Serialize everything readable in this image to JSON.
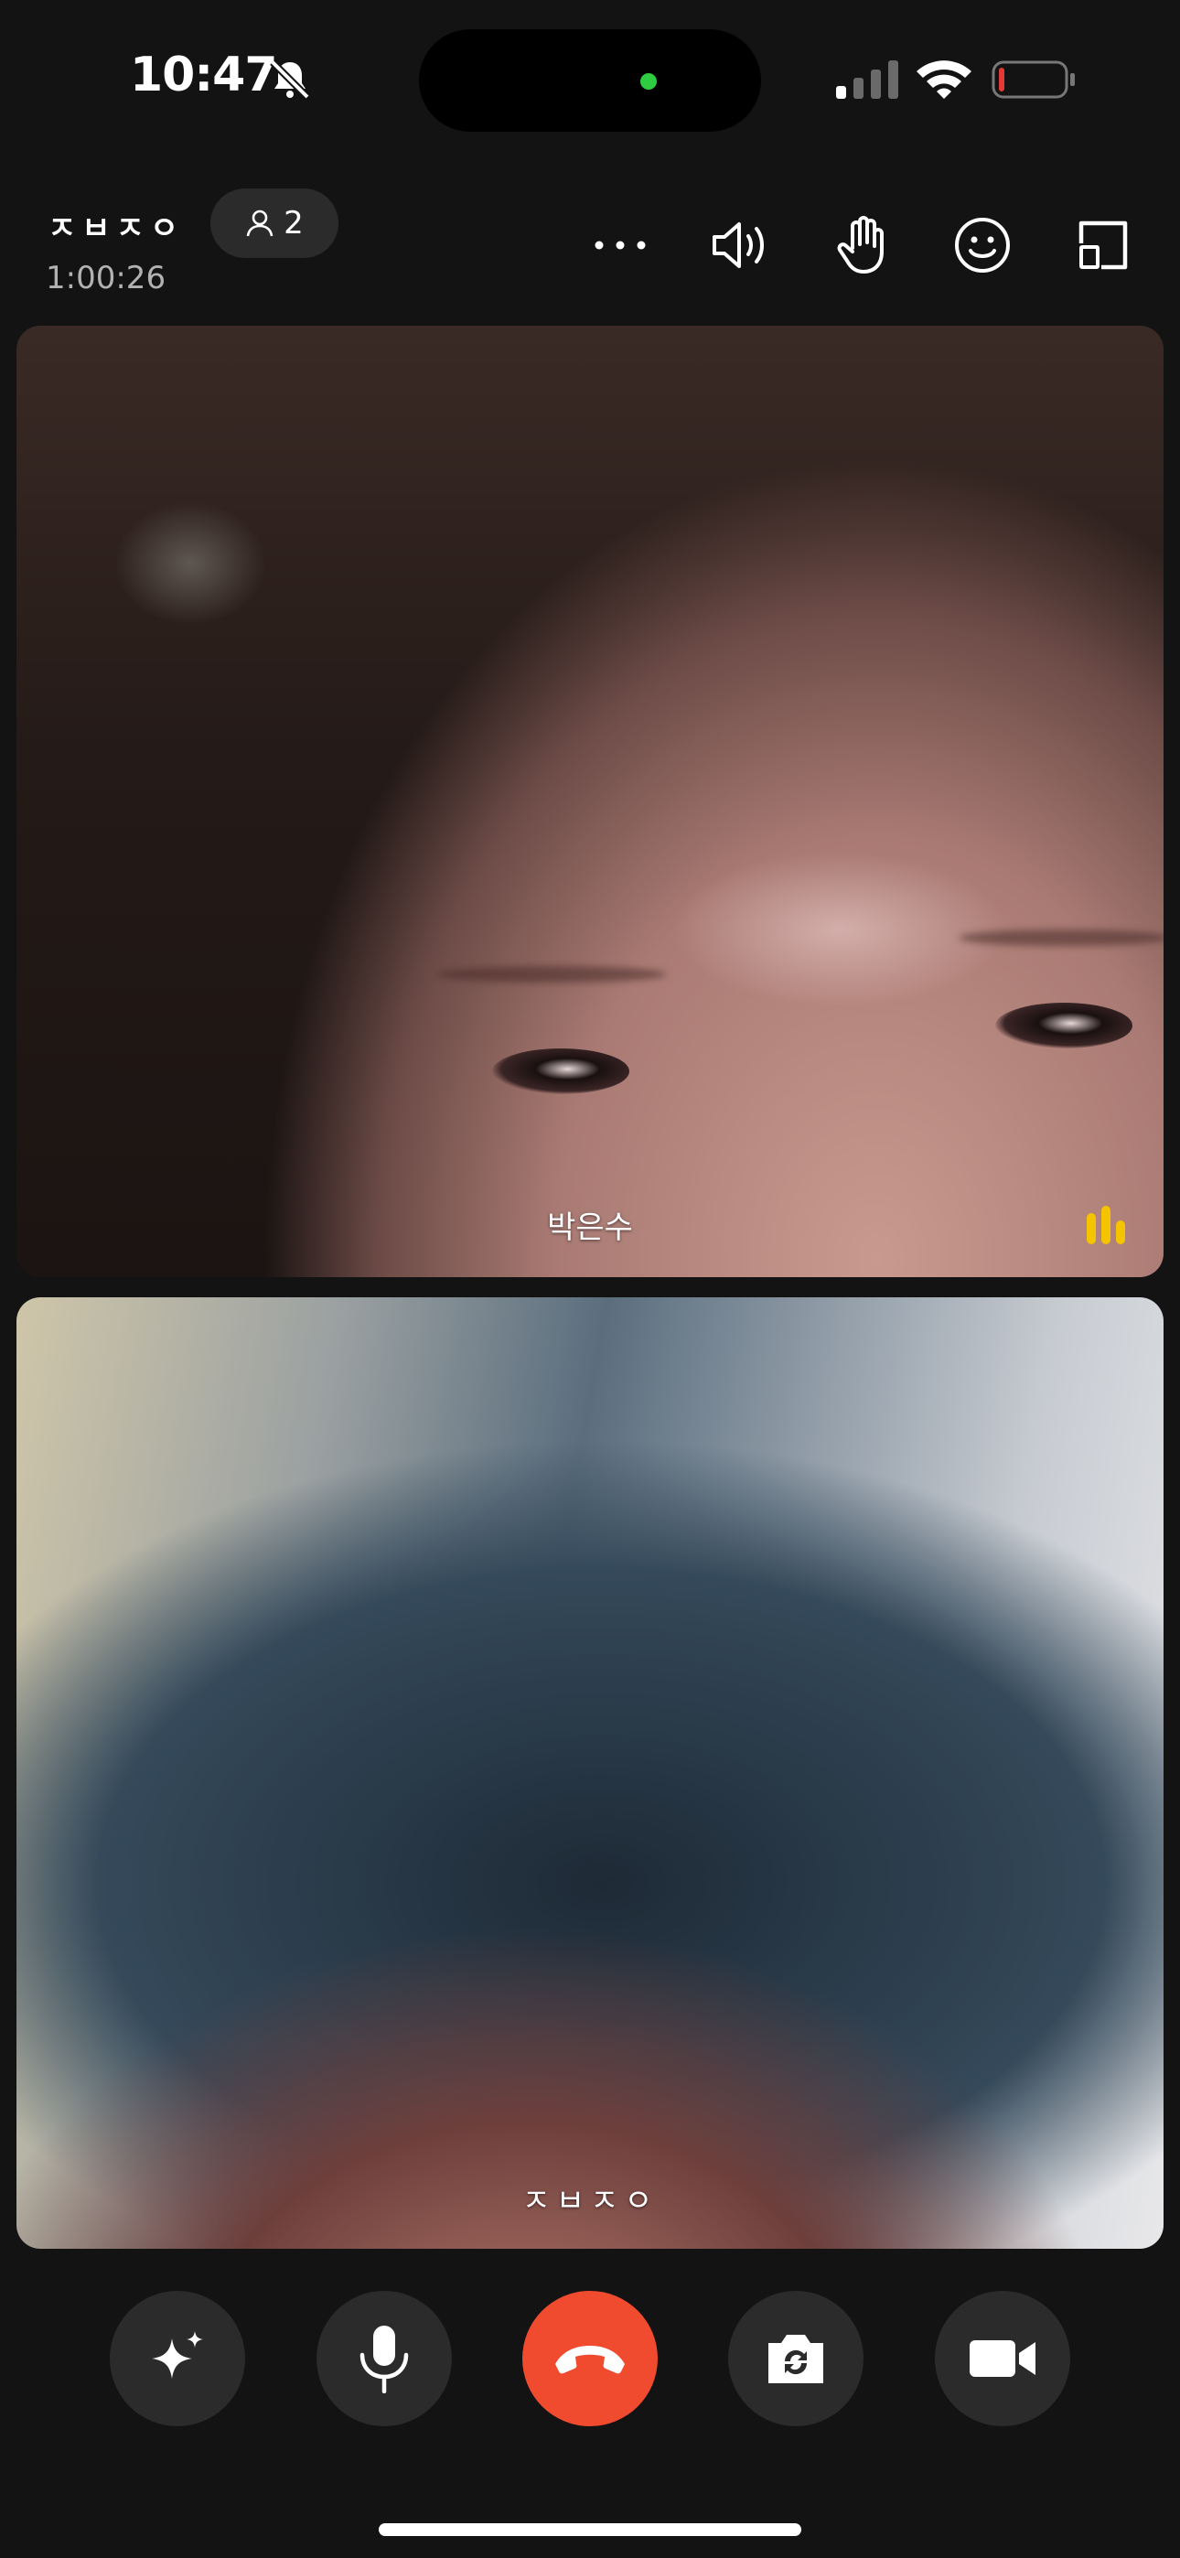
{
  "status_bar": {
    "time": "10:47",
    "icons": [
      "bell-muted-icon",
      "cellular-signal-icon",
      "wifi-icon",
      "battery-low-icon"
    ],
    "battery_color": "#e53935"
  },
  "call": {
    "title": "ㅈㅂㅈㅇ",
    "participant_count": "2",
    "duration": "1:00:26"
  },
  "header_actions": [
    {
      "name": "more-options-icon"
    },
    {
      "name": "speaker-icon"
    },
    {
      "name": "raise-hand-icon"
    },
    {
      "name": "emoji-reaction-icon"
    },
    {
      "name": "layout-toggle-icon"
    }
  ],
  "videos": [
    {
      "name": "박은수",
      "speaking": true
    },
    {
      "name": "ㅈㅂㅈㅇ",
      "speaking": false
    }
  ],
  "controls": [
    {
      "name": "effects-sparkle-icon"
    },
    {
      "name": "microphone-icon"
    },
    {
      "name": "end-call-icon",
      "color": "#f04a2f"
    },
    {
      "name": "switch-camera-icon"
    },
    {
      "name": "video-camera-icon"
    }
  ],
  "colors": {
    "background": "#131313",
    "speaking_indicator": "#f5c400",
    "end_call": "#f04a2f"
  }
}
